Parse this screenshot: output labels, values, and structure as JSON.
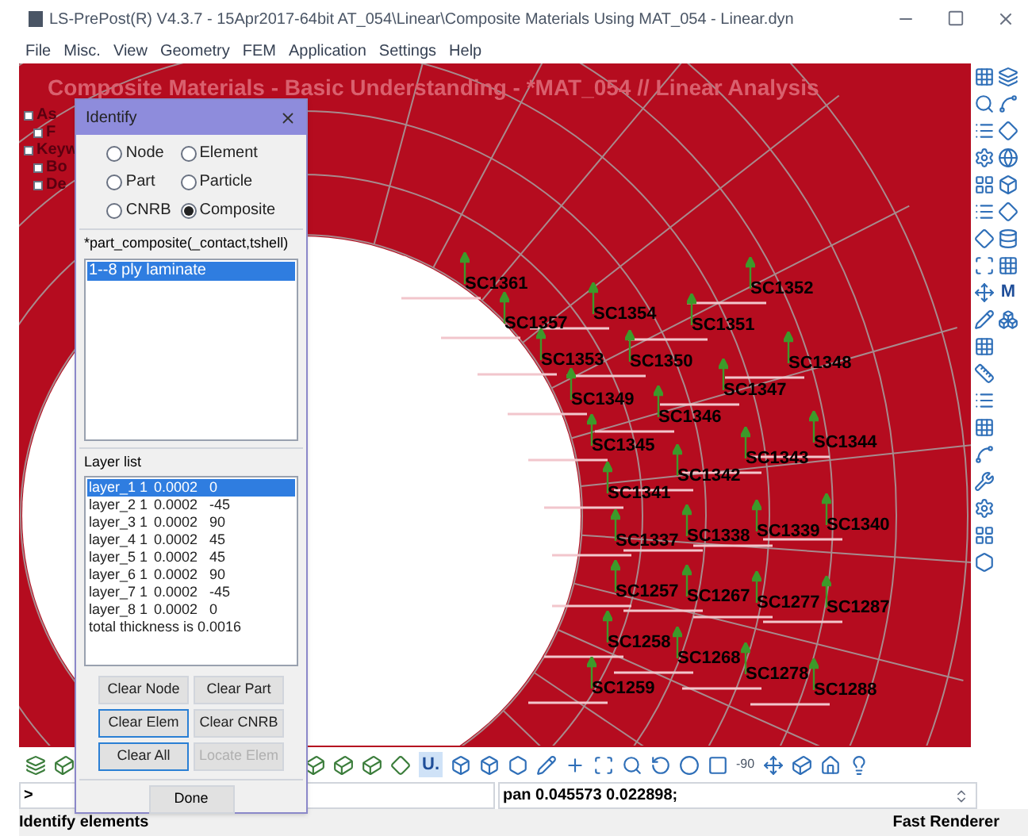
{
  "window": {
    "title": "LS-PrePost(R) V4.3.7 - 15Apr2017-64bit AT_054\\Linear\\Composite Materials Using MAT_054 - Linear.dyn"
  },
  "menu": [
    "File",
    "Misc.",
    "View",
    "Geometry",
    "FEM",
    "Application",
    "Settings",
    "Help"
  ],
  "viewport": {
    "heading": "Composite Materials - Basic Understanding - *MAT_054 // Linear Analysis",
    "tree": [
      {
        "label": "As",
        "children": [
          {
            "label": "F"
          }
        ]
      },
      {
        "label": "Keyw",
        "children": [
          {
            "label": "Bo"
          },
          {
            "label": "De"
          }
        ]
      }
    ],
    "element_labels": [
      "SC1361",
      "SC1357",
      "SC1354",
      "SC1352",
      "SC1351",
      "SC1353",
      "SC1350",
      "SC1348",
      "SC1349",
      "SC1346",
      "SC1347",
      "SC1345",
      "SC1344",
      "SC1343",
      "SC1342",
      "SC1341",
      "SC1337",
      "SC1338",
      "SC1339",
      "SC1340",
      "SC1257",
      "SC1267",
      "SC1277",
      "SC1287",
      "SC1258",
      "SC1268",
      "SC1278",
      "SC1288",
      "SC1259"
    ]
  },
  "dialog": {
    "title": "Identify",
    "options": [
      {
        "label": "Node",
        "selected": false
      },
      {
        "label": "Element",
        "selected": false
      },
      {
        "label": "Part",
        "selected": false
      },
      {
        "label": "Particle",
        "selected": false
      },
      {
        "label": "CNRB",
        "selected": false
      },
      {
        "label": "Composite",
        "selected": true
      }
    ],
    "part_heading": "*part_composite(_contact,tshell)",
    "parts": [
      {
        "label": "1--8 ply laminate",
        "selected": true
      }
    ],
    "layer_heading": "Layer list",
    "layers": [
      {
        "name": "layer_1",
        "column_2": "1",
        "thickness": "0.0002",
        "angle": "0",
        "selected": true
      },
      {
        "name": "layer_2",
        "column_2": "1",
        "thickness": "0.0002",
        "angle": "-45",
        "selected": false
      },
      {
        "name": "layer_3",
        "column_2": "1",
        "thickness": "0.0002",
        "angle": "90",
        "selected": false
      },
      {
        "name": "layer_4",
        "column_2": "1",
        "thickness": "0.0002",
        "angle": "45",
        "selected": false
      },
      {
        "name": "layer_5",
        "column_2": "1",
        "thickness": "0.0002",
        "angle": "45",
        "selected": false
      },
      {
        "name": "layer_6",
        "column_2": "1",
        "thickness": "0.0002",
        "angle": "90",
        "selected": false
      },
      {
        "name": "layer_7",
        "column_2": "1",
        "thickness": "0.0002",
        "angle": "-45",
        "selected": false
      },
      {
        "name": "layer_8",
        "column_2": "1",
        "thickness": "0.0002",
        "angle": "0",
        "selected": false
      }
    ],
    "total": "total thickness is 0.0016",
    "buttons": [
      {
        "label": "Clear Node",
        "highlighted": false,
        "disabled": false
      },
      {
        "label": "Clear Part",
        "highlighted": false,
        "disabled": false
      },
      {
        "label": "Clear Elem",
        "highlighted": true,
        "disabled": false
      },
      {
        "label": "Clear CNRB",
        "highlighted": false,
        "disabled": false
      },
      {
        "label": "Clear All",
        "highlighted": true,
        "disabled": false
      },
      {
        "label": "Locate Elem",
        "highlighted": false,
        "disabled": true
      }
    ],
    "done": "Done"
  },
  "bottom_toolbar": {
    "texts": [
      "U.",
      "-90"
    ]
  },
  "right_toolbar": {
    "text": "M"
  },
  "command": {
    "prompt": ">",
    "history": "pan 0.045573 0.022898;"
  },
  "status_bar": {
    "left": "Identify elements",
    "right": "Fast Renderer"
  }
}
